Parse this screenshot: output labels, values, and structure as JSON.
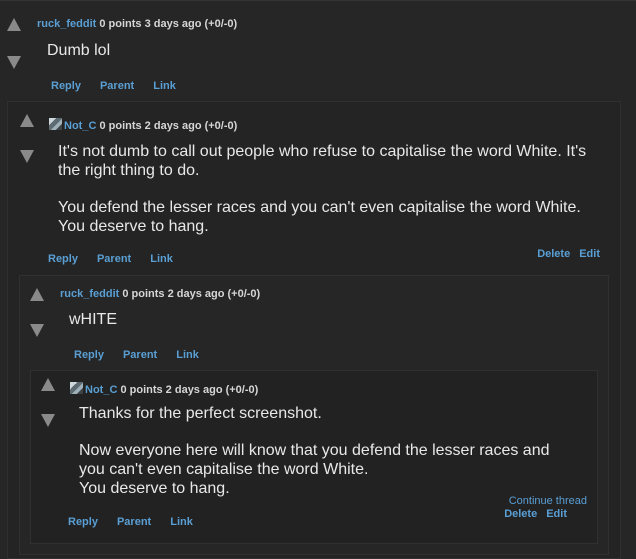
{
  "comments": [
    {
      "user": "ruck_feddit",
      "meta": "0 points 3 days ago (+0/-0)",
      "body": [
        "Dumb lol"
      ],
      "links": [
        "Reply",
        "Parent",
        "Link"
      ]
    },
    {
      "user": "Not_C",
      "meta": "0 points 2 days ago (+0/-0)",
      "body": [
        "It's not dumb to call out people who refuse to capitalise the word White. It's the right thing to do.",
        "You defend the lesser races and you can't even capitalise the word White. You deserve to hang."
      ],
      "links": [
        "Reply",
        "Parent",
        "Link"
      ],
      "owner_links": [
        "Delete",
        "Edit"
      ]
    },
    {
      "user": "ruck_feddit",
      "meta": "0 points 2 days ago (+0/-0)",
      "body": [
        "wHITE"
      ],
      "links": [
        "Reply",
        "Parent",
        "Link"
      ]
    },
    {
      "user": "Not_C",
      "meta": "0 points 2 days ago (+0/-0)",
      "body": [
        "Thanks for the perfect screenshot.",
        "Now everyone here will know that you defend the lesser races and you can't even capitalise the word White.",
        "You deserve to hang."
      ],
      "links": [
        "Reply",
        "Parent",
        "Link"
      ],
      "continue": "Continue thread",
      "owner_links": [
        "Delete",
        "Edit"
      ]
    }
  ]
}
